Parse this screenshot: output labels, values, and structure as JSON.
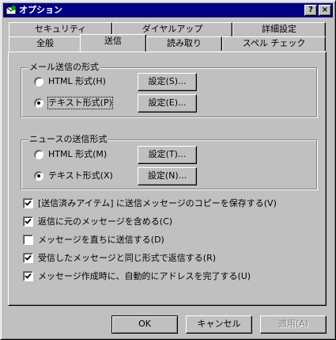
{
  "window": {
    "title": "オプション",
    "help_btn": "?",
    "close_btn": "×"
  },
  "tabs": {
    "row1": [
      "セキュリティ",
      "ダイヤルアップ",
      "詳細設定"
    ],
    "row2": [
      "全般",
      "送信",
      "読み取り",
      "スペル チェック"
    ],
    "active": "送信"
  },
  "mail_group": {
    "label": "メール送信の形式",
    "html_label": "HTML 形式(H)",
    "text_label": "テキスト形式(P)",
    "html_settings": "設定(S)...",
    "text_settings": "設定(E)...",
    "selected": "text"
  },
  "news_group": {
    "label": "ニュースの送信形式",
    "html_label": "HTML 形式(M)",
    "text_label": "テキスト形式(X)",
    "html_settings": "設定(T)...",
    "text_settings": "設定(N)...",
    "selected": "text"
  },
  "checkboxes": [
    {
      "label": "[送信済みアイテム] に送信メッセージのコピーを保存する(V)",
      "checked": true
    },
    {
      "label": "返信に元のメッセージを含める(C)",
      "checked": true
    },
    {
      "label": "メッセージを直ちに送信する(D)",
      "checked": false
    },
    {
      "label": "受信したメッセージと同じ形式で返信する(R)",
      "checked": true
    },
    {
      "label": "メッセージ作成時に、自動的にアドレスを完了する(U)",
      "checked": true
    }
  ],
  "footer": {
    "ok": "OK",
    "cancel": "キャンセル",
    "apply": "適用(A)"
  }
}
